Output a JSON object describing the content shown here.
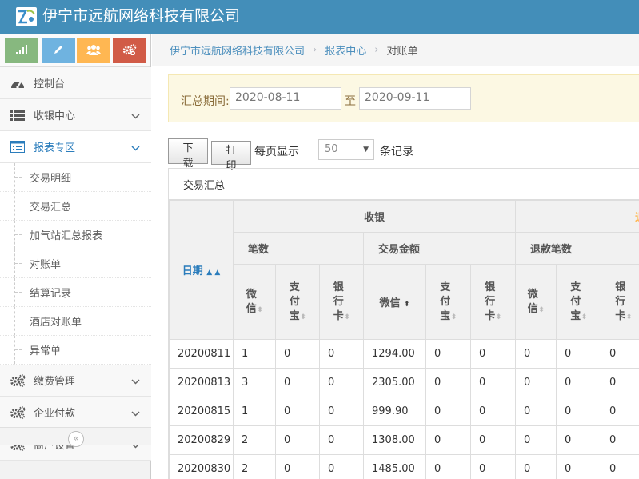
{
  "app": {
    "title": "伊宁市远航网络科技有限公司"
  },
  "shortcuts": [
    {
      "name": "chart-icon",
      "color": "#87b87f"
    },
    {
      "name": "pencil-icon",
      "color": "#6fb3e0"
    },
    {
      "name": "users-icon",
      "color": "#ffb752"
    },
    {
      "name": "cogs-icon",
      "color": "#d15b47"
    }
  ],
  "sidebar": {
    "items": [
      {
        "label": "控制台",
        "icon": "tachometer-icon"
      },
      {
        "label": "收银中心",
        "icon": "list-icon"
      },
      {
        "label": "报表专区",
        "icon": "list-alt-icon",
        "active": true
      },
      {
        "label": "缴费管理",
        "icon": "cogs-icon"
      },
      {
        "label": "企业付款",
        "icon": "cogs-icon"
      },
      {
        "label": "商户设置",
        "icon": "cogs-icon"
      }
    ],
    "report_sub": [
      "交易明细",
      "交易汇总",
      "加气站汇总报表",
      "对账单",
      "结算记录",
      "酒店对账单",
      "异常单"
    ],
    "collapse_glyph": "«"
  },
  "breadcrumb": {
    "home": "伊宁市远航网络科技有限公司",
    "section": "报表中心",
    "current": "对账单",
    "sep": "›"
  },
  "filter": {
    "label": "汇总期间:",
    "from": "2020-08-11",
    "to_label": "至",
    "to": "2020-09-11"
  },
  "toolbar": {
    "download": "下载",
    "print": "打印",
    "per_page_label": "每页显示",
    "per_page_value": "50",
    "per_page_suffix": "条记录"
  },
  "panel": {
    "title": "交易汇总"
  },
  "table": {
    "date_header": "日期",
    "group_cashier": "收银",
    "group_refund_partial": "退",
    "sub_count": "笔数",
    "sub_amount": "交易金额",
    "sub_refund_count": "退款笔数",
    "col_wechat": "微信",
    "col_alipay": "支付宝",
    "col_bank": "银行卡",
    "rows": [
      {
        "date": "20200811",
        "c1": "1",
        "c2": "0",
        "c3": "0",
        "a1": "1294.00",
        "a2": "0",
        "a3": "0",
        "r1": "0",
        "r2": "0",
        "r3": "0"
      },
      {
        "date": "20200813",
        "c1": "3",
        "c2": "0",
        "c3": "0",
        "a1": "2305.00",
        "a2": "0",
        "a3": "0",
        "r1": "0",
        "r2": "0",
        "r3": "0"
      },
      {
        "date": "20200815",
        "c1": "1",
        "c2": "0",
        "c3": "0",
        "a1": "999.90",
        "a2": "0",
        "a3": "0",
        "r1": "0",
        "r2": "0",
        "r3": "0"
      },
      {
        "date": "20200829",
        "c1": "2",
        "c2": "0",
        "c3": "0",
        "a1": "1308.00",
        "a2": "0",
        "a3": "0",
        "r1": "0",
        "r2": "0",
        "r3": "0"
      },
      {
        "date": "20200830",
        "c1": "2",
        "c2": "0",
        "c3": "0",
        "a1": "1485.00",
        "a2": "0",
        "a3": "0",
        "r1": "0",
        "r2": "0",
        "r3": "0"
      }
    ]
  },
  "colors": {
    "header": "#438eb9",
    "link": "#4c8fbd",
    "active": "#2b7dbc",
    "filter_bg": "#fcf8e3"
  }
}
